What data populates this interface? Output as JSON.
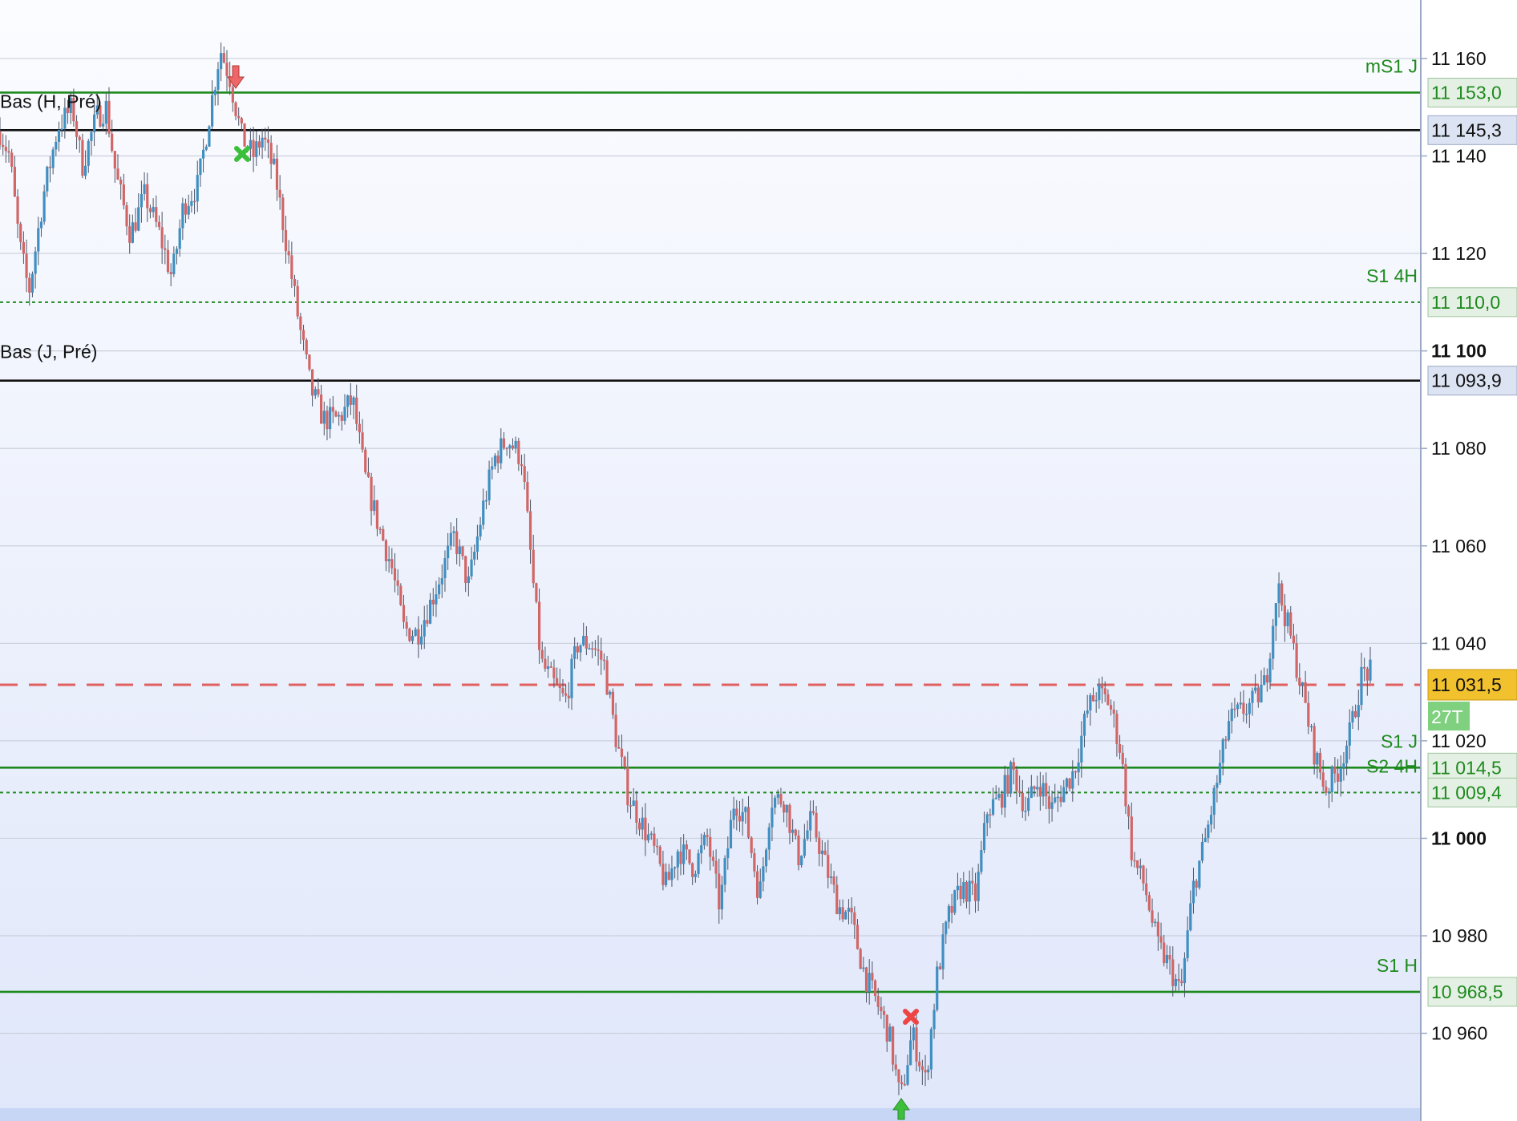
{
  "chart_data": {
    "type": "candlestick",
    "y_axis": {
      "range": [
        10942,
        11172
      ],
      "ticks": [
        {
          "value": 11160,
          "label": "11 160",
          "bold": false
        },
        {
          "value": 11140,
          "label": "11 140",
          "bold": false
        },
        {
          "value": 11120,
          "label": "11 120",
          "bold": false
        },
        {
          "value": 11100,
          "label": "11 100",
          "bold": true
        },
        {
          "value": 11080,
          "label": "11 080",
          "bold": false
        },
        {
          "value": 11060,
          "label": "11 060",
          "bold": false
        },
        {
          "value": 11040,
          "label": "11 040",
          "bold": false
        },
        {
          "value": 11020,
          "label": "11 020",
          "bold": false
        },
        {
          "value": 11000,
          "label": "11 000",
          "bold": true
        },
        {
          "value": 10980,
          "label": "10 980",
          "bold": false
        },
        {
          "value": 10960,
          "label": "10 960",
          "bold": false
        }
      ]
    },
    "levels": [
      {
        "value": 11153.0,
        "label": "11 153,0",
        "name": "mS1 J",
        "color": "#1e8a1e",
        "style": "solid"
      },
      {
        "value": 11145.3,
        "label": "11 145,3",
        "name": "Bas (H, Pré)",
        "color": "#111111",
        "style": "solid"
      },
      {
        "value": 11110.0,
        "label": "11 110,0",
        "name": "S1 4H",
        "color": "#1e8a1e",
        "style": "dotted"
      },
      {
        "value": 11093.9,
        "label": "11 093,9",
        "name": "Bas (J, Pré)",
        "color": "#111111",
        "style": "solid"
      },
      {
        "value": 11014.5,
        "label": "11 014,5",
        "name": "S1 J",
        "color": "#1e8a1e",
        "style": "solid"
      },
      {
        "value": 11009.4,
        "label": "11 009,4",
        "name": "S2 4H",
        "color": "#1e8a1e",
        "style": "dotted"
      },
      {
        "value": 10968.5,
        "label": "10 968,5",
        "name": "S1 H",
        "color": "#1e8a1e",
        "style": "solid"
      }
    ],
    "current_price": {
      "value": 11031.5,
      "label": "11 031,5",
      "badge": "27T",
      "color": "#e06060"
    },
    "price_path": [
      [
        0,
        11145
      ],
      [
        10,
        11140
      ],
      [
        20,
        11122
      ],
      [
        30,
        11112
      ],
      [
        45,
        11132
      ],
      [
        60,
        11146
      ],
      [
        75,
        11150
      ],
      [
        85,
        11138
      ],
      [
        100,
        11148
      ],
      [
        110,
        11150
      ],
      [
        120,
        11136
      ],
      [
        135,
        11124
      ],
      [
        150,
        11132
      ],
      [
        165,
        11124
      ],
      [
        178,
        11115
      ],
      [
        190,
        11130
      ],
      [
        205,
        11134
      ],
      [
        218,
        11150
      ],
      [
        228,
        11162
      ],
      [
        238,
        11156
      ],
      [
        250,
        11144
      ],
      [
        262,
        11140
      ],
      [
        272,
        11144
      ],
      [
        285,
        11136
      ],
      [
        298,
        11120
      ],
      [
        310,
        11105
      ],
      [
        322,
        11092
      ],
      [
        335,
        11086
      ],
      [
        350,
        11086
      ],
      [
        365,
        11090
      ],
      [
        378,
        11074
      ],
      [
        392,
        11064
      ],
      [
        405,
        11056
      ],
      [
        418,
        11043
      ],
      [
        432,
        11042
      ],
      [
        445,
        11048
      ],
      [
        458,
        11055
      ],
      [
        470,
        11062
      ],
      [
        485,
        11052
      ],
      [
        500,
        11068
      ],
      [
        512,
        11078
      ],
      [
        525,
        11082
      ],
      [
        540,
        11078
      ],
      [
        552,
        11052
      ],
      [
        560,
        11036
      ],
      [
        572,
        11032
      ],
      [
        585,
        11028
      ],
      [
        598,
        11040
      ],
      [
        612,
        11040
      ],
      [
        625,
        11036
      ],
      [
        638,
        11020
      ],
      [
        650,
        11009
      ],
      [
        662,
        11004
      ],
      [
        676,
        10998
      ],
      [
        690,
        10990
      ],
      [
        702,
        10998
      ],
      [
        718,
        10994
      ],
      [
        732,
        11000
      ],
      [
        745,
        10986
      ],
      [
        760,
        11008
      ],
      [
        772,
        11004
      ],
      [
        786,
        10988
      ],
      [
        798,
        11008
      ],
      [
        812,
        11008
      ],
      [
        826,
        10996
      ],
      [
        840,
        11004
      ],
      [
        855,
        10994
      ],
      [
        868,
        10986
      ],
      [
        880,
        10984
      ],
      [
        895,
        10972
      ],
      [
        908,
        10966
      ],
      [
        920,
        10960
      ],
      [
        932,
        10946
      ],
      [
        944,
        10960
      ],
      [
        958,
        10950
      ],
      [
        970,
        10972
      ],
      [
        982,
        10984
      ],
      [
        995,
        10990
      ],
      [
        1010,
        10988
      ],
      [
        1022,
        11006
      ],
      [
        1035,
        11008
      ],
      [
        1048,
        11014
      ],
      [
        1062,
        11006
      ],
      [
        1075,
        11012
      ],
      [
        1088,
        11006
      ],
      [
        1100,
        11010
      ],
      [
        1112,
        11014
      ],
      [
        1125,
        11026
      ],
      [
        1135,
        11030
      ],
      [
        1148,
        11028
      ],
      [
        1160,
        11018
      ],
      [
        1172,
        10996
      ],
      [
        1185,
        10990
      ],
      [
        1198,
        10978
      ],
      [
        1210,
        10974
      ],
      [
        1222,
        10968
      ],
      [
        1235,
        10990
      ],
      [
        1248,
        11000
      ],
      [
        1260,
        11012
      ],
      [
        1272,
        11024
      ],
      [
        1285,
        11026
      ],
      [
        1298,
        11028
      ],
      [
        1310,
        11032
      ],
      [
        1322,
        11052
      ],
      [
        1335,
        11042
      ],
      [
        1348,
        11030
      ],
      [
        1360,
        11018
      ],
      [
        1372,
        11010
      ],
      [
        1385,
        11014
      ],
      [
        1398,
        11022
      ],
      [
        1410,
        11034
      ],
      [
        1420,
        11034
      ]
    ]
  }
}
